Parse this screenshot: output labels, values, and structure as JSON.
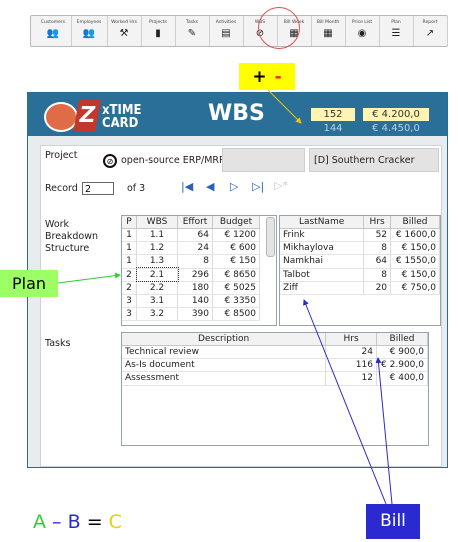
{
  "toolbar": {
    "items": [
      {
        "label": "Customers",
        "icon": "users-icon",
        "glyph": "👥"
      },
      {
        "label": "Employees",
        "icon": "employees-icon",
        "glyph": "👥"
      },
      {
        "label": "Worked Hrs",
        "icon": "tool-icon",
        "glyph": "⚒"
      },
      {
        "label": "Projects",
        "icon": "podium-icon",
        "glyph": "▮"
      },
      {
        "label": "Tasks",
        "icon": "pen-icon",
        "glyph": "✎"
      },
      {
        "label": "Activities",
        "icon": "clipboard-icon",
        "glyph": "▤"
      },
      {
        "label": "WBS",
        "icon": "compass-icon",
        "glyph": "⊘"
      },
      {
        "label": "Bill Week",
        "icon": "calendar-week-icon",
        "glyph": "▦"
      },
      {
        "label": "Bill Month",
        "icon": "calendar-month-icon",
        "glyph": "▦"
      },
      {
        "label": "Price List",
        "icon": "price-tag-icon",
        "glyph": "◉"
      },
      {
        "label": "Plan",
        "icon": "list-icon",
        "glyph": "☰"
      },
      {
        "label": "Report",
        "icon": "chart-icon",
        "glyph": "↗"
      }
    ]
  },
  "annotations": {
    "plus": "+",
    "minus": "-",
    "plan": "Plan",
    "bill": "Bill",
    "formula": {
      "a": "A",
      "dash": "–",
      "b": "B",
      "eq": "=",
      "c": "C"
    }
  },
  "app": {
    "logo_line1": "xTIME",
    "logo_line2": "CARD",
    "title": "WBS",
    "summary": {
      "plan_effort": "152",
      "plan_budget": "€ 4.200,0",
      "billed_hrs": "144",
      "billed_amount": "€ 4.450,0"
    },
    "project_label": "Project",
    "project_value": "open-source ERP/MRP",
    "customer_value": "[D] Southern Cracker",
    "record_label": "Record",
    "record_value": "2",
    "record_of": "of 3",
    "wbs_label": "Work\nBreakdown\nStructure",
    "tasks_label": "Tasks"
  },
  "wbs_table": {
    "headers": [
      "P",
      "WBS",
      "Effort",
      "Budget"
    ],
    "rows": [
      [
        "1",
        "1.1",
        "64",
        "€ 1200"
      ],
      [
        "1",
        "1.2",
        "24",
        "€ 600"
      ],
      [
        "1",
        "1.3",
        "8",
        "€ 150"
      ],
      [
        "2",
        "2.1",
        "296",
        "€ 8650"
      ],
      [
        "2",
        "2.2",
        "180",
        "€ 5025"
      ],
      [
        "3",
        "3.1",
        "140",
        "€ 3350"
      ],
      [
        "3",
        "3.2",
        "390",
        "€ 8500"
      ]
    ]
  },
  "bill_table": {
    "headers": [
      "LastName",
      "Hrs",
      "Billed"
    ],
    "rows": [
      [
        "Frink",
        "52",
        "€ 1600,0"
      ],
      [
        "Mikhaylova",
        "8",
        "€ 150,0"
      ],
      [
        "Namkhai",
        "64",
        "€ 1550,0"
      ],
      [
        "Talbot",
        "8",
        "€ 150,0"
      ],
      [
        "Ziff",
        "20",
        "€ 750,0"
      ]
    ]
  },
  "tasks_table": {
    "headers": [
      "Description",
      "Hrs",
      "Billed"
    ],
    "rows": [
      [
        "Technical review",
        "24",
        "€ 900,0"
      ],
      [
        "As-Is document",
        "116",
        "€ 2.900,0"
      ],
      [
        "Assessment",
        "12",
        "€ 400,0"
      ]
    ]
  },
  "colors": {
    "header_blue": "#2a6f97",
    "annotation_yellow": "#ffff00",
    "annotation_green": "#9cff66",
    "annotation_blue": "#2a2ad0"
  }
}
